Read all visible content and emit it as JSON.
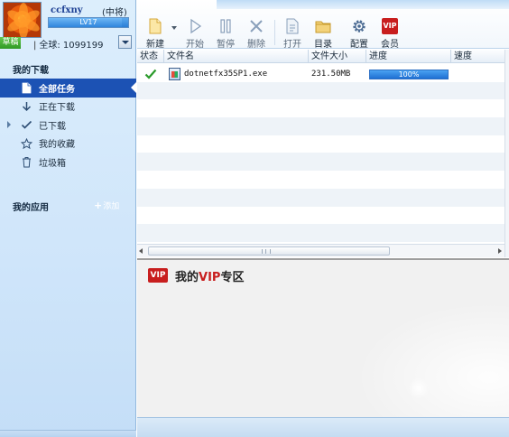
{
  "profile": {
    "username": "ccfxny",
    "rank": "(中将)",
    "level": "LV17",
    "level_progress": 0.92,
    "status": "草稿",
    "global_rank": "全球: 1099199"
  },
  "sidebar": {
    "downloads_title": "我的下载",
    "items": [
      {
        "label": "全部任务",
        "icon": "document-icon",
        "active": true
      },
      {
        "label": "正在下载",
        "icon": "download-arrow-icon"
      },
      {
        "label": "已下载",
        "icon": "checkmark-icon"
      },
      {
        "label": "我的收藏",
        "icon": "star-icon"
      },
      {
        "label": "垃圾箱",
        "icon": "trash-icon"
      }
    ],
    "apps_title": "我的应用",
    "add_label": "添加"
  },
  "toolbar": {
    "new_label": "新建",
    "start_label": "开始",
    "pause_label": "暂停",
    "delete_label": "删除",
    "open_label": "打开",
    "folder_label": "目录",
    "settings_label": "配置",
    "vip_label": "会员",
    "vip_icon_text": "VIP"
  },
  "list": {
    "columns": [
      "状态",
      "文件名",
      "文件大小",
      "进度",
      "速度"
    ],
    "task": {
      "file_name": "dotnetfx35SP1.exe",
      "file_size": "231.50MB",
      "progress_text": "100%",
      "progress": 1.0,
      "status_icon": "checkmark-icon"
    }
  },
  "vip_zone": {
    "badge": "VIP",
    "title_prefix": "我的",
    "title_vip": "VIP",
    "title_suffix": "专区"
  },
  "colors": {
    "accent": "#1c52b4",
    "vip_red": "#c81e1e",
    "check_green": "#2a9a2a"
  }
}
